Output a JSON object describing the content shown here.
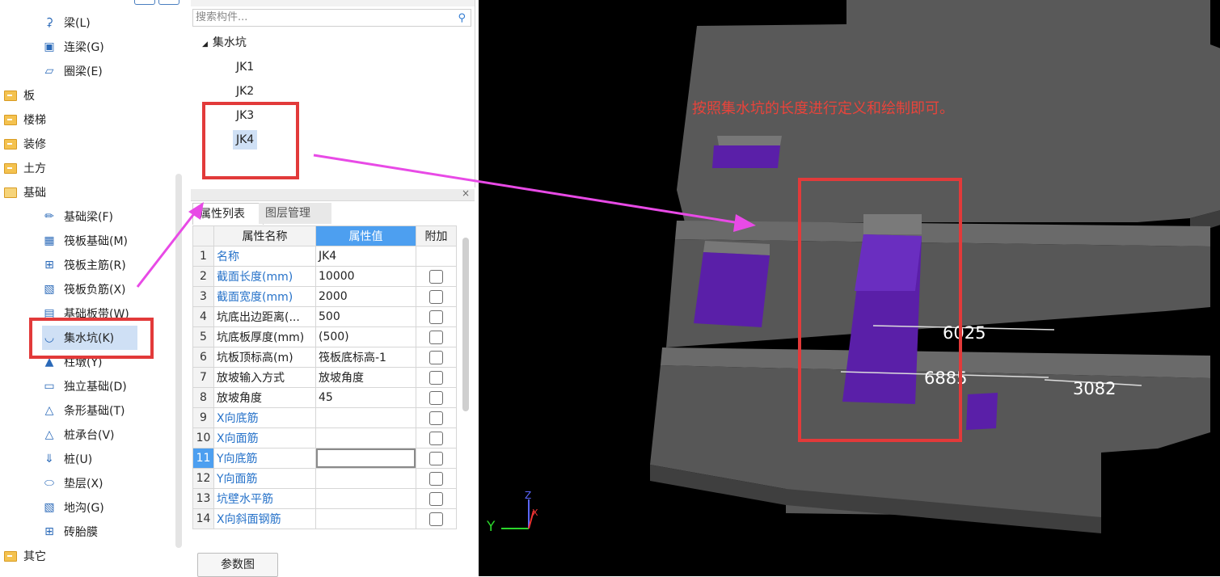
{
  "tree": {
    "items": [
      {
        "label": "梁(L)",
        "icon": "beam-icon",
        "level": 2
      },
      {
        "label": "连梁(G)",
        "icon": "coupling-beam-icon",
        "level": 2
      },
      {
        "label": "圈梁(E)",
        "icon": "ring-beam-icon",
        "level": 2
      },
      {
        "label": "板",
        "icon": "folder-icon",
        "level": 1
      },
      {
        "label": "楼梯",
        "icon": "folder-icon",
        "level": 1
      },
      {
        "label": "装修",
        "icon": "folder-icon",
        "level": 1
      },
      {
        "label": "土方",
        "icon": "folder-icon",
        "level": 1
      },
      {
        "label": "基础",
        "icon": "folder-open-icon",
        "level": 1
      },
      {
        "label": "基础梁(F)",
        "icon": "foundation-beam-icon",
        "level": 2
      },
      {
        "label": "筏板基础(M)",
        "icon": "raft-foundation-icon",
        "level": 2
      },
      {
        "label": "筏板主筋(R)",
        "icon": "raft-main-rebar-icon",
        "level": 2
      },
      {
        "label": "筏板负筋(X)",
        "icon": "raft-negative-rebar-icon",
        "level": 2
      },
      {
        "label": "基础板带(W)",
        "icon": "foundation-strip-icon",
        "level": 2
      },
      {
        "label": "集水坑(K)",
        "icon": "sump-pit-icon",
        "level": 2,
        "selected": true
      },
      {
        "label": "柱墩(Y)",
        "icon": "column-pier-icon",
        "level": 2
      },
      {
        "label": "独立基础(D)",
        "icon": "isolated-footing-icon",
        "level": 2
      },
      {
        "label": "条形基础(T)",
        "icon": "strip-footing-icon",
        "level": 2
      },
      {
        "label": "桩承台(V)",
        "icon": "pile-cap-icon",
        "level": 2
      },
      {
        "label": "桩(U)",
        "icon": "pile-icon",
        "level": 2
      },
      {
        "label": "垫层(X)",
        "icon": "cushion-layer-icon",
        "level": 2
      },
      {
        "label": "地沟(G)",
        "icon": "trench-icon",
        "level": 2
      },
      {
        "label": "砖胎膜",
        "icon": "brick-mold-icon",
        "level": 2
      },
      {
        "label": "其它",
        "icon": "folder-icon",
        "level": 1
      }
    ]
  },
  "components": {
    "search_placeholder": "搜索构件...",
    "group": "集水坑",
    "items": [
      "JK1",
      "JK2",
      "JK3",
      "JK4"
    ],
    "selected": "JK4"
  },
  "properties": {
    "tabs": [
      "属性列表",
      "图层管理"
    ],
    "headers": {
      "name": "属性名称",
      "value": "属性值",
      "extra": "附加"
    },
    "rows": [
      {
        "num": "1",
        "name": "名称",
        "value": "JK4",
        "blue": true,
        "checkbox": false
      },
      {
        "num": "2",
        "name": "截面长度(mm)",
        "value": "10000",
        "blue": true,
        "checkbox": true
      },
      {
        "num": "3",
        "name": "截面宽度(mm)",
        "value": "2000",
        "blue": true,
        "checkbox": true
      },
      {
        "num": "4",
        "name": "坑底出边距离(...",
        "value": "500",
        "blue": false,
        "checkbox": true
      },
      {
        "num": "5",
        "name": "坑底板厚度(mm)",
        "value": "(500)",
        "blue": false,
        "checkbox": true
      },
      {
        "num": "6",
        "name": "坑板顶标高(m)",
        "value": "筏板底标高-1",
        "blue": false,
        "checkbox": true
      },
      {
        "num": "7",
        "name": "放坡输入方式",
        "value": "放坡角度",
        "blue": false,
        "checkbox": true
      },
      {
        "num": "8",
        "name": "放坡角度",
        "value": "45",
        "blue": false,
        "checkbox": true
      },
      {
        "num": "9",
        "name": "X向底筋",
        "value": "",
        "blue": true,
        "checkbox": true
      },
      {
        "num": "10",
        "name": "X向面筋",
        "value": "",
        "blue": true,
        "checkbox": true
      },
      {
        "num": "11",
        "name": "Y向底筋",
        "value": "",
        "blue": true,
        "checkbox": true
      },
      {
        "num": "12",
        "name": "Y向面筋",
        "value": "",
        "blue": true,
        "checkbox": true
      },
      {
        "num": "13",
        "name": "坑壁水平筋",
        "value": "",
        "blue": true,
        "checkbox": true
      },
      {
        "num": "14",
        "name": "X向斜面钢筋",
        "value": "",
        "blue": true,
        "checkbox": true
      }
    ],
    "current_row": "11",
    "param_button": "参数图"
  },
  "viewport": {
    "note": "按照集水坑的长度进行定义和绘制即可。",
    "dimensions": [
      "6025",
      "6885",
      "3082"
    ],
    "axes": {
      "y": "Y",
      "z": "Z",
      "x": "X"
    }
  },
  "colors": {
    "accent": "#4d9ff0",
    "annotation": "#e23a3a",
    "arrow": "#e84ae6",
    "pit": "#5a1fa8",
    "slab": "#555555"
  }
}
